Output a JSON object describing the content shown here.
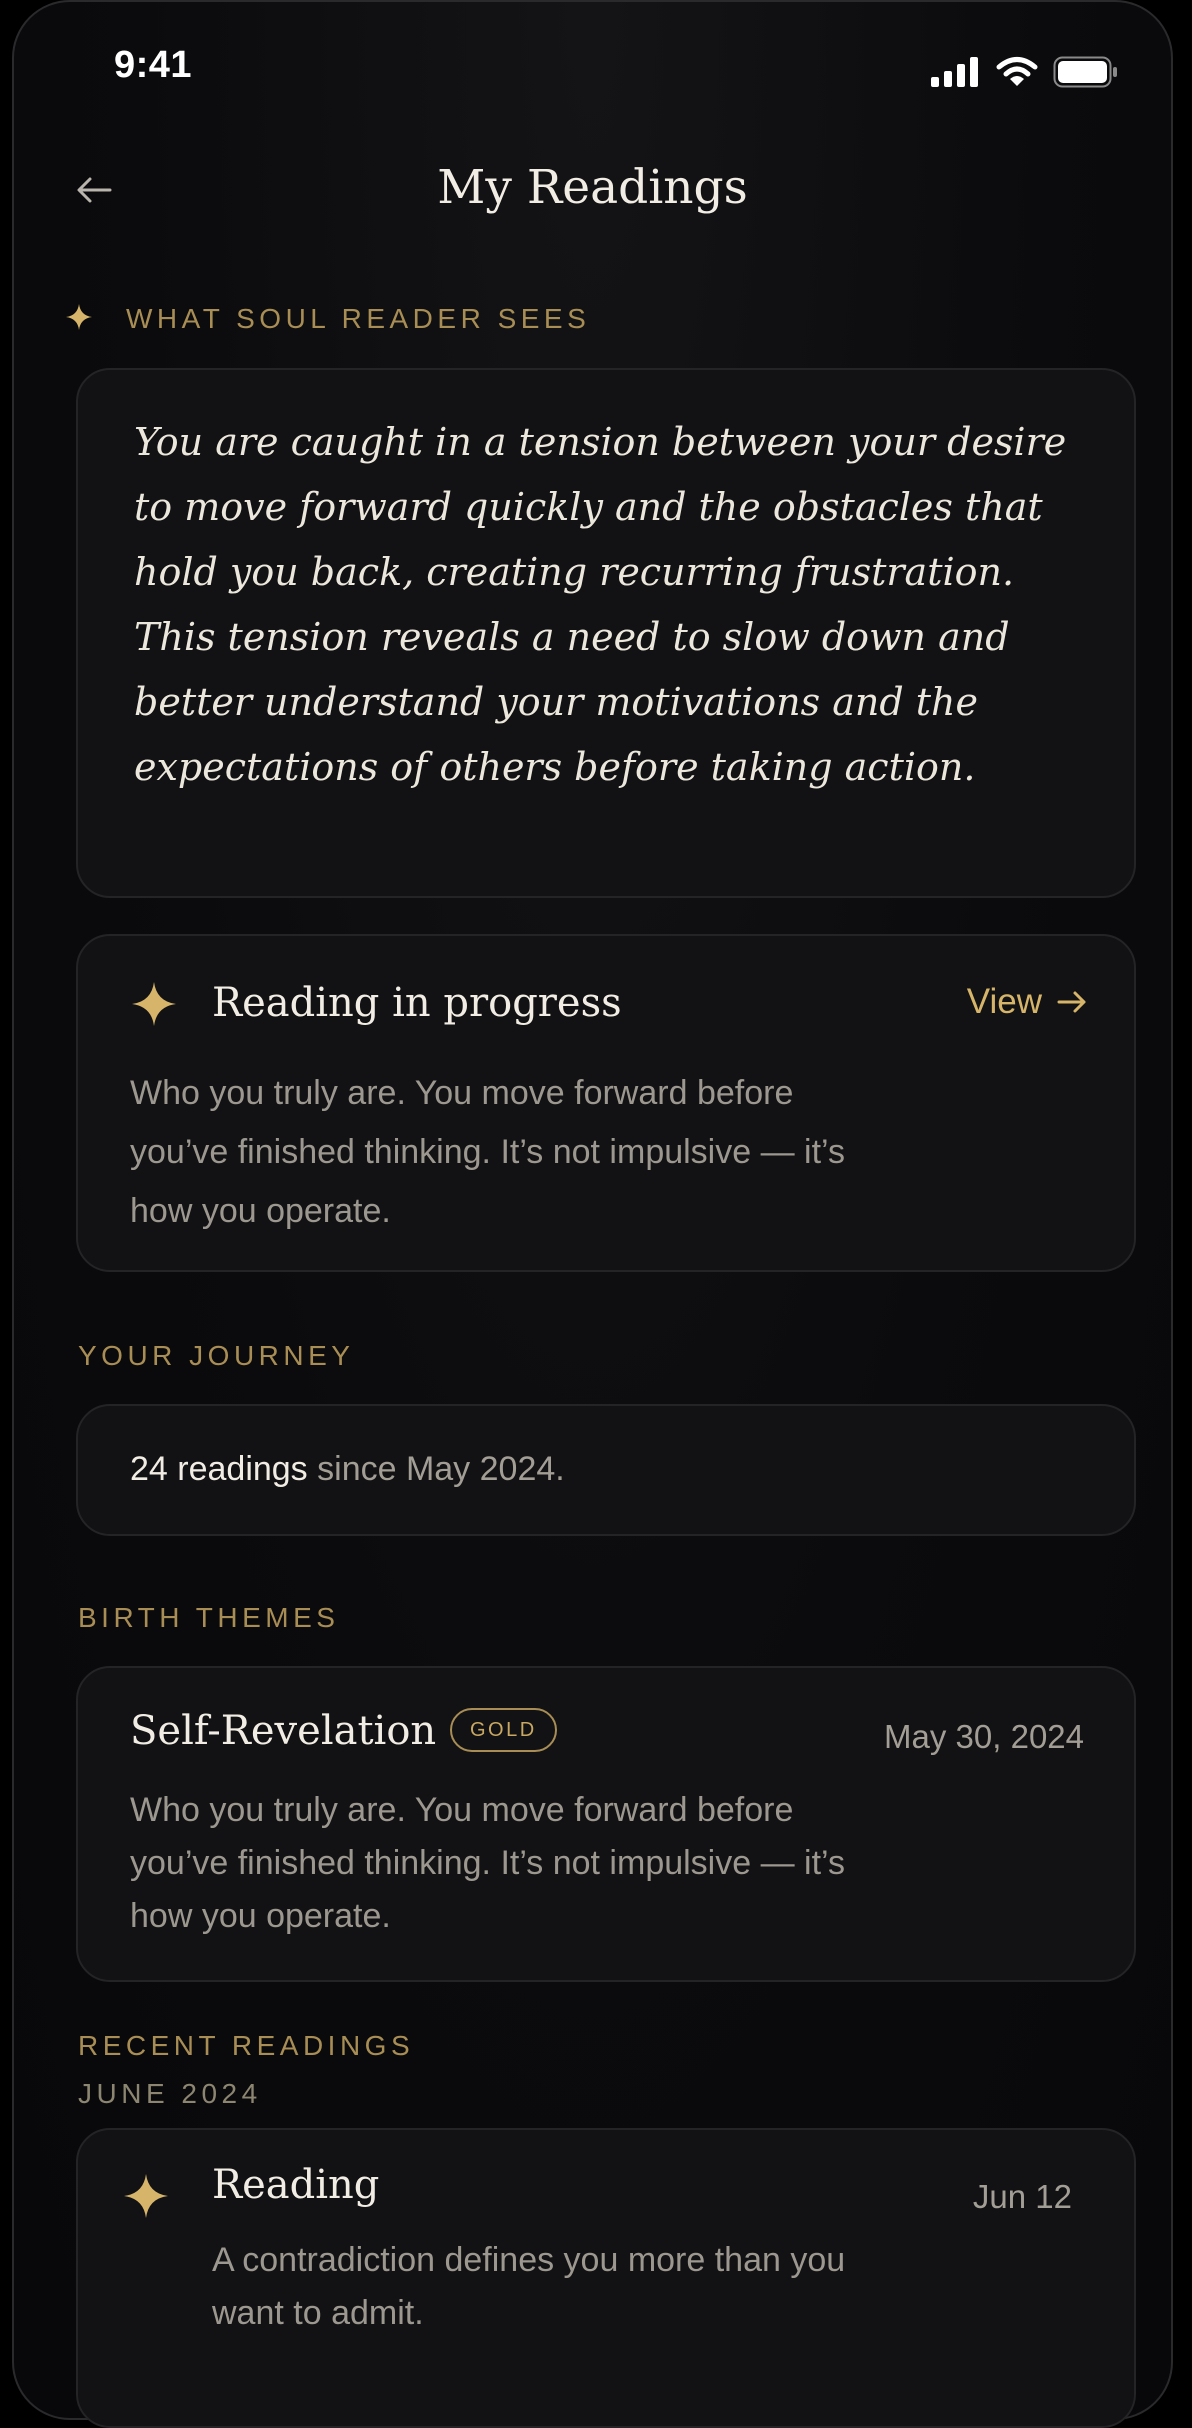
{
  "status_bar": {
    "time": "9:41"
  },
  "header": {
    "title": "My Readings",
    "back_icon": "arrow-left-icon"
  },
  "soul_reader": {
    "label": "WHAT SOUL READER SEES",
    "icon": "sparkle-icon",
    "quote": "You are caught in a tension between your desire to move forward quickly and the obstacles that hold you back, creating recurring frustration. This tension reveals a need to slow down and better understand your motivations and the expectations of others before taking action."
  },
  "reading_in_progress": {
    "icon": "sparkle-icon",
    "title": "Reading in progress",
    "link_label": "View",
    "body": "Who you truly are. You move forward before you’ve finished thinking. It’s not impulsive — it’s how you operate."
  },
  "journey": {
    "label": "YOUR JOURNEY",
    "count_text": "24 readings",
    "since_text": " since May 2024."
  },
  "birth_themes": {
    "label": "BIRTH THEMES",
    "items": [
      {
        "title": "Self-Revelation",
        "badge": "GOLD",
        "date": "May 30, 2024",
        "body": "Who you truly are. You move forward before you’ve finished thinking. It’s not impulsive — it’s how you operate."
      }
    ]
  },
  "recent_readings": {
    "label": "RECENT READINGS",
    "month": "JUNE 2024",
    "items": [
      {
        "icon": "sparkle-icon",
        "title": "Reading",
        "date": "Jun 12",
        "body": "A contradiction defines you more than you want to admit."
      }
    ]
  },
  "colors": {
    "background": "#0b0b0d",
    "card": "#121214",
    "gold": "#d6b56a",
    "gold_muted": "#a88d55",
    "text_primary": "#f1ede4",
    "text_secondary": "#9c9890"
  }
}
